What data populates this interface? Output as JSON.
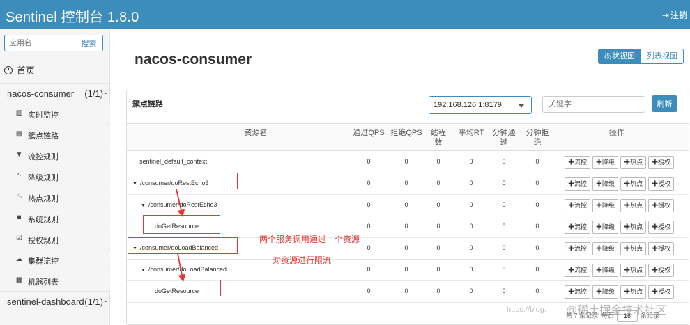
{
  "header": {
    "title": "Sentinel 控制台 1.8.0",
    "logout_label": "注销",
    "logout_icon": "sign-out-icon"
  },
  "sidebar": {
    "search_placeholder": "应用名",
    "search_button": "搜索",
    "home_label": "首页",
    "apps": [
      {
        "name": "nacos-consumer",
        "count": "(1/1)",
        "items": [
          {
            "label": "实时监控",
            "icon": "bar-chart-icon"
          },
          {
            "label": "簇点链路",
            "icon": "list-icon"
          },
          {
            "label": "流控规则",
            "icon": "filter-icon"
          },
          {
            "label": "降级规则",
            "icon": "flash-icon"
          },
          {
            "label": "热点规则",
            "icon": "fire-icon"
          },
          {
            "label": "系统规则",
            "icon": "lock-icon"
          },
          {
            "label": "授权规则",
            "icon": "check-square-icon"
          },
          {
            "label": "集群流控",
            "icon": "cloud-icon"
          },
          {
            "label": "机器列表",
            "icon": "th-list-icon"
          }
        ]
      },
      {
        "name": "sentinel-dashboard",
        "count": "(1/1)"
      }
    ]
  },
  "main": {
    "title": "nacos-consumer",
    "view_tree": "树状视图",
    "view_list": "列表视图",
    "panel_title": "簇点链路",
    "machine": "192.168.126.1:8179",
    "keyword_placeholder": "关键字",
    "refresh": "刷新",
    "columns": {
      "resource": "资源名",
      "pass_qps": "通过QPS",
      "block_qps": "拒绝QPS",
      "threads_1": "线程",
      "threads_2": "数",
      "avg_rt": "平均RT",
      "min_pass_1": "分钟通",
      "min_pass_2": "过",
      "min_block_1": "分钟拒",
      "min_block_2": "绝",
      "ops": "操作"
    },
    "ops": {
      "flow": "流控",
      "degrade": "降级",
      "hot": "热点",
      "auth": "授权"
    },
    "rows": [
      {
        "name": "sentinel_default_context",
        "pass": "0",
        "block": "0",
        "threads": "0",
        "rt": "0",
        "min_pass": "0",
        "min_block": "0"
      },
      {
        "name": "/consumer/doRestEcho3",
        "pass": "0",
        "block": "0",
        "threads": "0",
        "rt": "0",
        "min_pass": "0",
        "min_block": "0"
      },
      {
        "name": "/consumer/doRestEcho3",
        "pass": "0",
        "block": "0",
        "threads": "0",
        "rt": "0",
        "min_pass": "0",
        "min_block": "0"
      },
      {
        "name": "doGetResource",
        "pass": "0",
        "block": "0",
        "threads": "0",
        "rt": "0",
        "min_pass": "0",
        "min_block": "0"
      },
      {
        "name": "/consumer/doLoadBalanced",
        "pass": "0",
        "block": "0",
        "threads": "0",
        "rt": "0",
        "min_pass": "0",
        "min_block": "0"
      },
      {
        "name": "/consumer/doLoadBalanced",
        "pass": "0",
        "block": "0",
        "threads": "0",
        "rt": "0",
        "min_pass": "0",
        "min_block": "0"
      },
      {
        "name": "doGetResource",
        "pass": "0",
        "block": "0",
        "threads": "0",
        "rt": "0",
        "min_pass": "0",
        "min_block": "0"
      }
    ],
    "pager": {
      "prefix": "共 7 条记录, 每页",
      "page_size": "16",
      "suffix": "条记录"
    }
  },
  "annotations": {
    "line1": "两个服务调用通过一个资源",
    "line2": "对资源进行限流"
  },
  "watermark": {
    "small": "https://blog.",
    "big": "@稀土掘金技术社区"
  },
  "colors": {
    "primary": "#3c8dbc",
    "annotation": "#e53935"
  }
}
